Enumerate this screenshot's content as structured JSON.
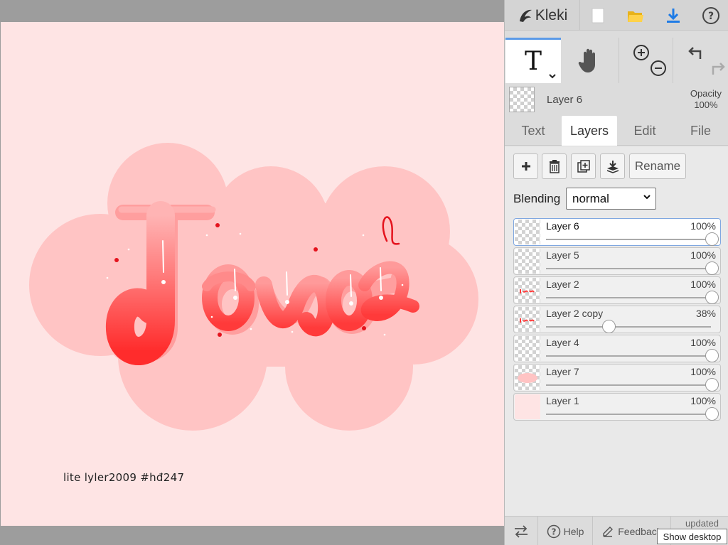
{
  "app": {
    "logo_text": "Kleki",
    "icons": {
      "logo": "kleki-logo-icon",
      "new": "new-document-icon",
      "open": "open-folder-icon",
      "save": "download-icon",
      "help": "help-icon"
    }
  },
  "tools": {
    "active": "text",
    "text_tool_label": "T",
    "items": [
      "text-tool-icon",
      "hand-tool-icon",
      "zoom-in-icon",
      "zoom-out-icon",
      "undo-icon",
      "redo-icon"
    ]
  },
  "current_layer": {
    "name": "Layer 6",
    "opacity_label": "Opacity",
    "opacity_value": "100%"
  },
  "tabs": [
    {
      "label": "Text",
      "active": false
    },
    {
      "label": "Layers",
      "active": true
    },
    {
      "label": "Edit",
      "active": false
    },
    {
      "label": "File",
      "active": false
    }
  ],
  "layer_buttons": {
    "rename_label": "Rename",
    "icons": [
      "add-layer-icon",
      "delete-layer-icon",
      "duplicate-layer-icon",
      "merge-down-icon"
    ]
  },
  "blending": {
    "label": "Blending",
    "value": "normal"
  },
  "layers": [
    {
      "name": "Layer 6",
      "opacity": "100%",
      "level": 1.0,
      "selected": true,
      "thumb": "transparent"
    },
    {
      "name": "Layer 5",
      "opacity": "100%",
      "level": 1.0,
      "selected": false,
      "thumb": "transparent"
    },
    {
      "name": "Layer 2",
      "opacity": "100%",
      "level": 1.0,
      "selected": false,
      "thumb": "lettering"
    },
    {
      "name": "Layer 2 copy",
      "opacity": "38%",
      "level": 0.38,
      "selected": false,
      "thumb": "lettering"
    },
    {
      "name": "Layer 4",
      "opacity": "100%",
      "level": 1.0,
      "selected": false,
      "thumb": "transparent"
    },
    {
      "name": "Layer 7",
      "opacity": "100%",
      "level": 1.0,
      "selected": false,
      "thumb": "cloud"
    },
    {
      "name": "Layer 1",
      "opacity": "100%",
      "level": 1.0,
      "selected": false,
      "thumb": "fill"
    }
  ],
  "footer": {
    "help_label": "Help",
    "feedback_label": "Feedback",
    "updated_label": "updated",
    "tooltip": "Show desktop"
  },
  "canvas": {
    "signature": "lite  lyler2009  #hđ247",
    "colors": {
      "background": "#fee4e4",
      "cloud": "#ffc4c4",
      "accent": "#ff3a3a"
    }
  }
}
